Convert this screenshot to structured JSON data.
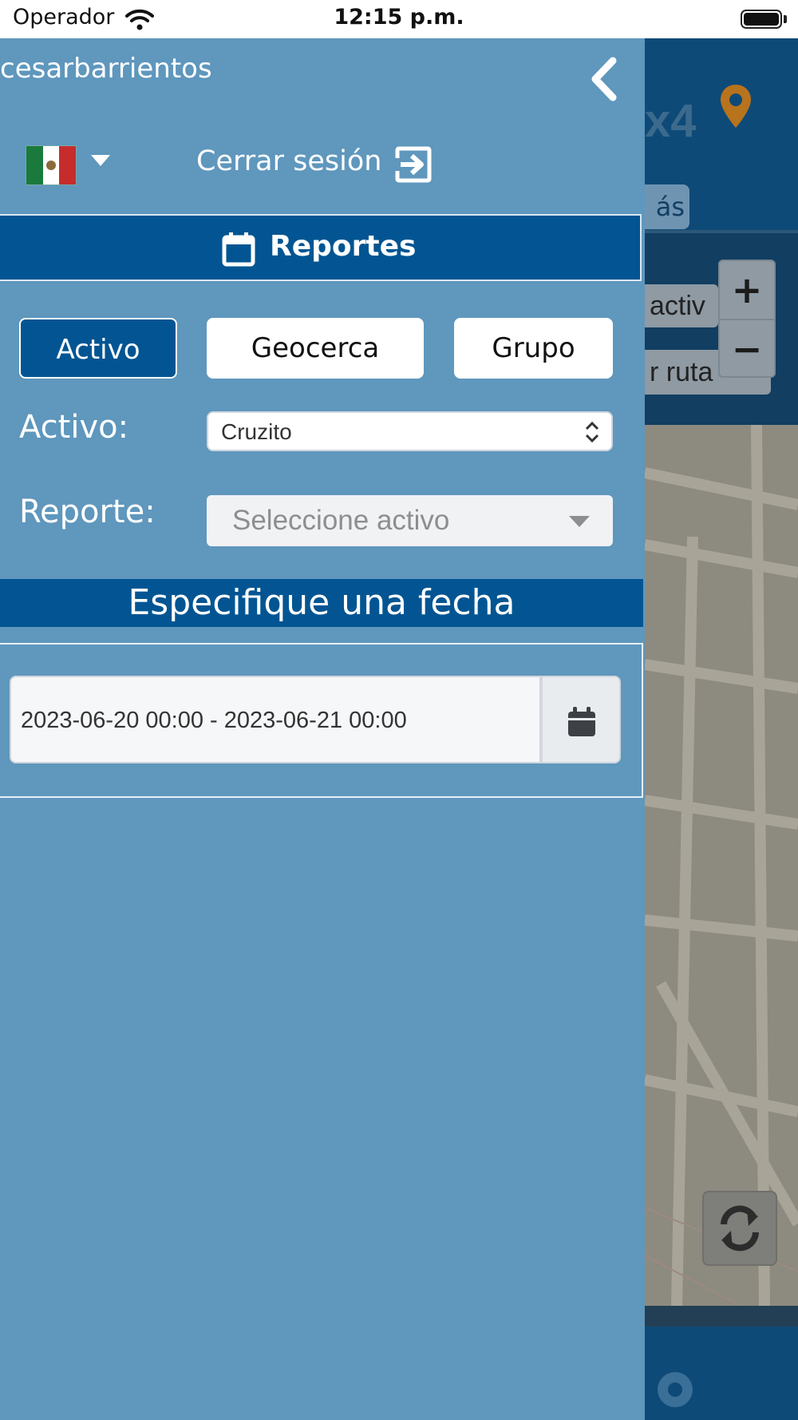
{
  "status_bar": {
    "carrier": "Operador",
    "time": "12:15 p.m."
  },
  "background_app": {
    "logo_text": "x4",
    "more_label": "ás",
    "pill_1": "activ",
    "pill_2": "r ruta",
    "zoom_in": "+",
    "zoom_out": "−"
  },
  "sidebar": {
    "username": "cesarbarrientos",
    "logout_label": "Cerrar sesión",
    "section_title": "Reportes",
    "tabs": {
      "active": "Activo",
      "geofence": "Geocerca",
      "group": "Grupo"
    },
    "asset_label": "Activo:",
    "asset_value": "Cruzito",
    "report_label": "Reporte:",
    "report_placeholder": "Seleccione activo",
    "date_heading": "Especifique una fecha",
    "date_range": "2023-06-20 00:00 - 2023-06-21 00:00"
  },
  "colors": {
    "sidebar_bg": "#5f97bd",
    "primary_blue": "#025592",
    "accent_orange": "#e98b1c"
  }
}
